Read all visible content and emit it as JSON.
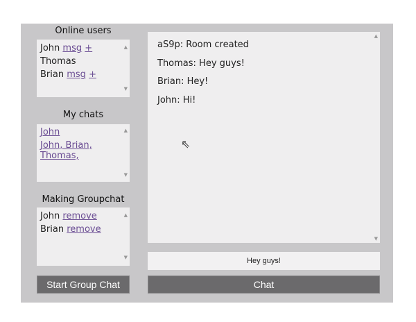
{
  "online_users": {
    "title": "Online users",
    "users": [
      {
        "name": "John",
        "msg": "msg",
        "add": "+"
      },
      {
        "name": "Thomas"
      },
      {
        "name": "Brian",
        "msg": "msg",
        "add": "+"
      }
    ]
  },
  "my_chats": {
    "title": "My chats",
    "items": [
      "John",
      "John, Brian, Thomas,"
    ]
  },
  "groupchat": {
    "title": "Making Groupchat",
    "members": [
      {
        "name": "John",
        "remove": "remove"
      },
      {
        "name": "Brian",
        "remove": "remove"
      }
    ],
    "start_button": "Start Group Chat"
  },
  "messages": [
    "aS9p: Room created",
    "Thomas: Hey guys!",
    "Brian: Hey!",
    "John: Hi!"
  ],
  "input": {
    "value": "Hey guys!"
  },
  "chat_button": "Chat",
  "colors": {
    "panel": "#c8c7c9",
    "link": "#6a4c93",
    "button": "#6b6a6c"
  }
}
